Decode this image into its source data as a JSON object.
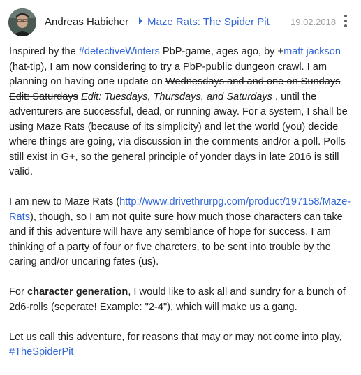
{
  "post": {
    "author": "Andreas Habicher",
    "collection": "Maze Rats: The Spider Pit",
    "date": "19.02.2018",
    "more_icon": "more-vert-icon",
    "p1": {
      "t1": "Inspired by the ",
      "hashtag1": "#detectiveWinters",
      "t2": " PbP-game, ages ago, by +",
      "mention": "matt jackson",
      "t3": " (hat-tip), I am now considering to try a PbP-public dungeon crawl. I am planning on having one update on ",
      "strike1": "Wednesdays and and one on Sundays",
      "t4": " ",
      "strike2": "Edit: Saturdays",
      "t5": " ",
      "italic_edit": "Edit: Tuesdays, Thursdays, and Saturdays",
      "t6": " , until the adventurers are successful, dead, or running away. For a system, I shall be using Maze Rats (because of its simplicity) and let the world (you) decide where things are going, via discussion in the comments and/or a poll. Polls still exist in G+, so the general principle of yonder days in late 2016 is still valid."
    },
    "p2": {
      "t1": "I am new to Maze Rats (",
      "url": "http://www.drivethrurpg.com/product/197158/Maze-Rats",
      "t2": "), though, so I am not quite sure how much those characters can take and if this adventure will have any semblance of hope for success. I am thinking of a party of four or five charcters, to be sent into trouble by the caring and/or uncaring fates (us)."
    },
    "p3": {
      "t1": "For ",
      "bold": "character generation",
      "t2": ", I would like to ask all and sundry for a bunch of 2d6-rolls (seperate! Example: \"2-4\"), which will make us a gang."
    },
    "p4": {
      "t1": "Let us call this adventure, for reasons that may or may not come into play, ",
      "hashtag": "#TheSpiderPit"
    }
  },
  "colors": {
    "link": "#3367d6",
    "text": "#212121",
    "date": "#9e9e9e"
  }
}
